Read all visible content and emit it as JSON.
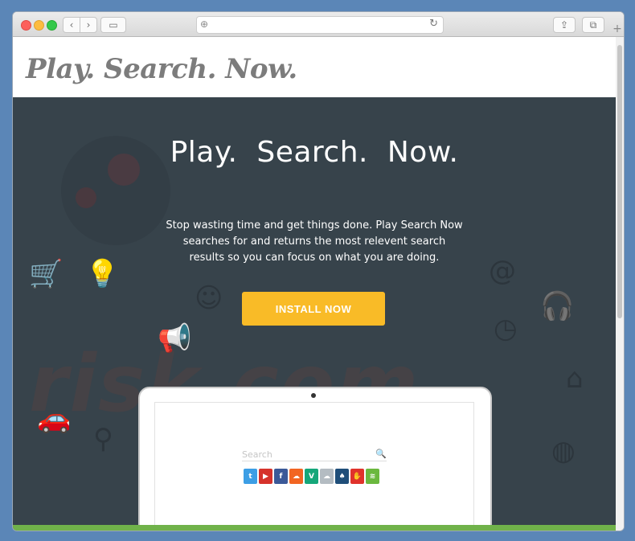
{
  "browser": {
    "address_icon": "⊕",
    "reload_icon": "↻",
    "back_icon": "‹",
    "forward_icon": "›",
    "sidebar_icon": "▭",
    "share_icon": "⇪",
    "tabs_icon": "⧉",
    "new_tab_icon": "+"
  },
  "header": {
    "logo_text": "Play.  Search.  Now."
  },
  "hero": {
    "title": "Play.  Search.  Now.",
    "description": "Stop wasting time and get things done.  Play Search Now searches for and returns the most relevent search results so you can focus on what you are doing.",
    "install_label": "INSTALL NOW",
    "watermark": "risk.com"
  },
  "laptop": {
    "search_placeholder": "Search",
    "search_icon": "🔍",
    "tiles": [
      {
        "icon": "twitter-icon",
        "glyph": "t",
        "color": "#3c9ee5"
      },
      {
        "icon": "youtube-icon",
        "glyph": "▶",
        "color": "#d6322b"
      },
      {
        "icon": "facebook-icon",
        "glyph": "f",
        "color": "#3b5998"
      },
      {
        "icon": "soundcloud-icon",
        "glyph": "☁",
        "color": "#f26522"
      },
      {
        "icon": "vine-icon",
        "glyph": "V",
        "color": "#15a77a"
      },
      {
        "icon": "cloud-icon",
        "glyph": "☁",
        "color": "#b4bcc2"
      },
      {
        "icon": "drop-icon",
        "glyph": "♠",
        "color": "#1f4e79"
      },
      {
        "icon": "hand-icon",
        "glyph": "✋",
        "color": "#e0322b"
      },
      {
        "icon": "spotify-icon",
        "glyph": "≋",
        "color": "#6bb83e"
      }
    ]
  },
  "colors": {
    "accent": "#f9bb27",
    "hero_bg": "#37434b",
    "footer_strip": "#70b24a"
  }
}
